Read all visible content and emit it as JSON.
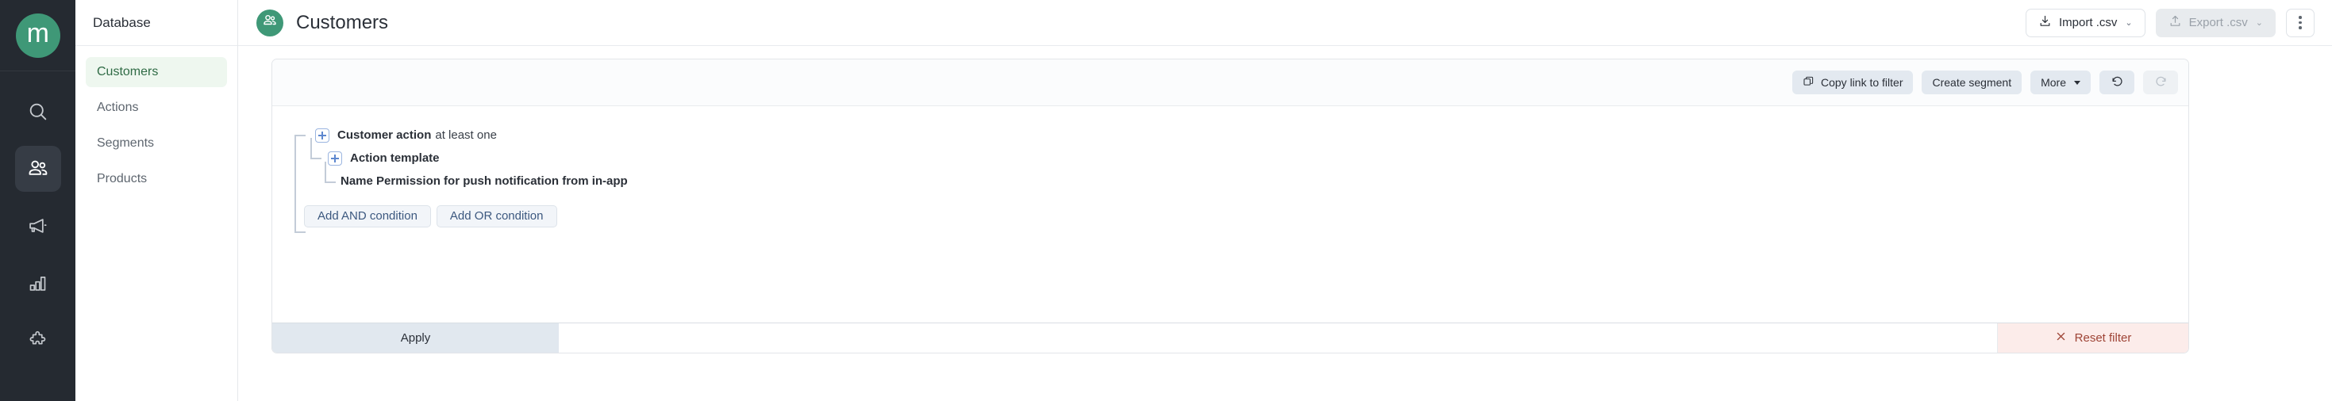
{
  "rail": {
    "logo_letter": "m",
    "items": [
      {
        "name": "search-icon",
        "label": "Search",
        "active": false
      },
      {
        "name": "users-icon",
        "label": "Customers",
        "active": true
      },
      {
        "name": "megaphone-icon",
        "label": "Campaigns",
        "active": false
      },
      {
        "name": "bar-chart-icon",
        "label": "Analytics",
        "active": false
      },
      {
        "name": "puzzle-icon",
        "label": "Integrations",
        "active": false
      }
    ]
  },
  "subnav": {
    "title": "Database",
    "items": [
      {
        "label": "Customers",
        "active": true
      },
      {
        "label": "Actions",
        "active": false
      },
      {
        "label": "Segments",
        "active": false
      },
      {
        "label": "Products",
        "active": false
      }
    ]
  },
  "topbar": {
    "title": "Customers",
    "avatar_icon": "users-icon",
    "import_label": "Import .csv",
    "import_icon": "download-icon",
    "export_label": "Export .csv",
    "export_icon": "upload-icon",
    "caret": "⌄",
    "more_menu_icon": "kebab-menu-icon"
  },
  "filter": {
    "toolbar": {
      "copy_link_label": "Copy link to filter",
      "copy_icon": "copy-icon",
      "create_segment_label": "Create segment",
      "more_label": "More",
      "undo_icon": "undo-icon",
      "redo_icon": "redo-icon"
    },
    "tree": {
      "node1_bold": "Customer action",
      "node1_rest": "at least one",
      "node2_bold": "Action template",
      "node3_bold": "Name Permission for push notification from in-app",
      "add_and_label": "Add AND condition",
      "add_or_label": "Add OR condition"
    },
    "bottom": {
      "apply_label": "Apply",
      "reset_label": "Reset filter",
      "reset_icon": "close-x-icon"
    }
  },
  "colors": {
    "brand_green": "#3f9877",
    "rail_bg": "#252a31",
    "active_nav_bg": "#eef7ef",
    "active_nav_text": "#2f6b45",
    "toolbar_btn_bg": "#e3e9f0",
    "apply_bg": "#e1e8ef",
    "reset_bg": "#fcecea",
    "reset_text": "#9e4436",
    "tree_link_blue": "#3c587f",
    "plus_blue": "#5d87cf"
  }
}
